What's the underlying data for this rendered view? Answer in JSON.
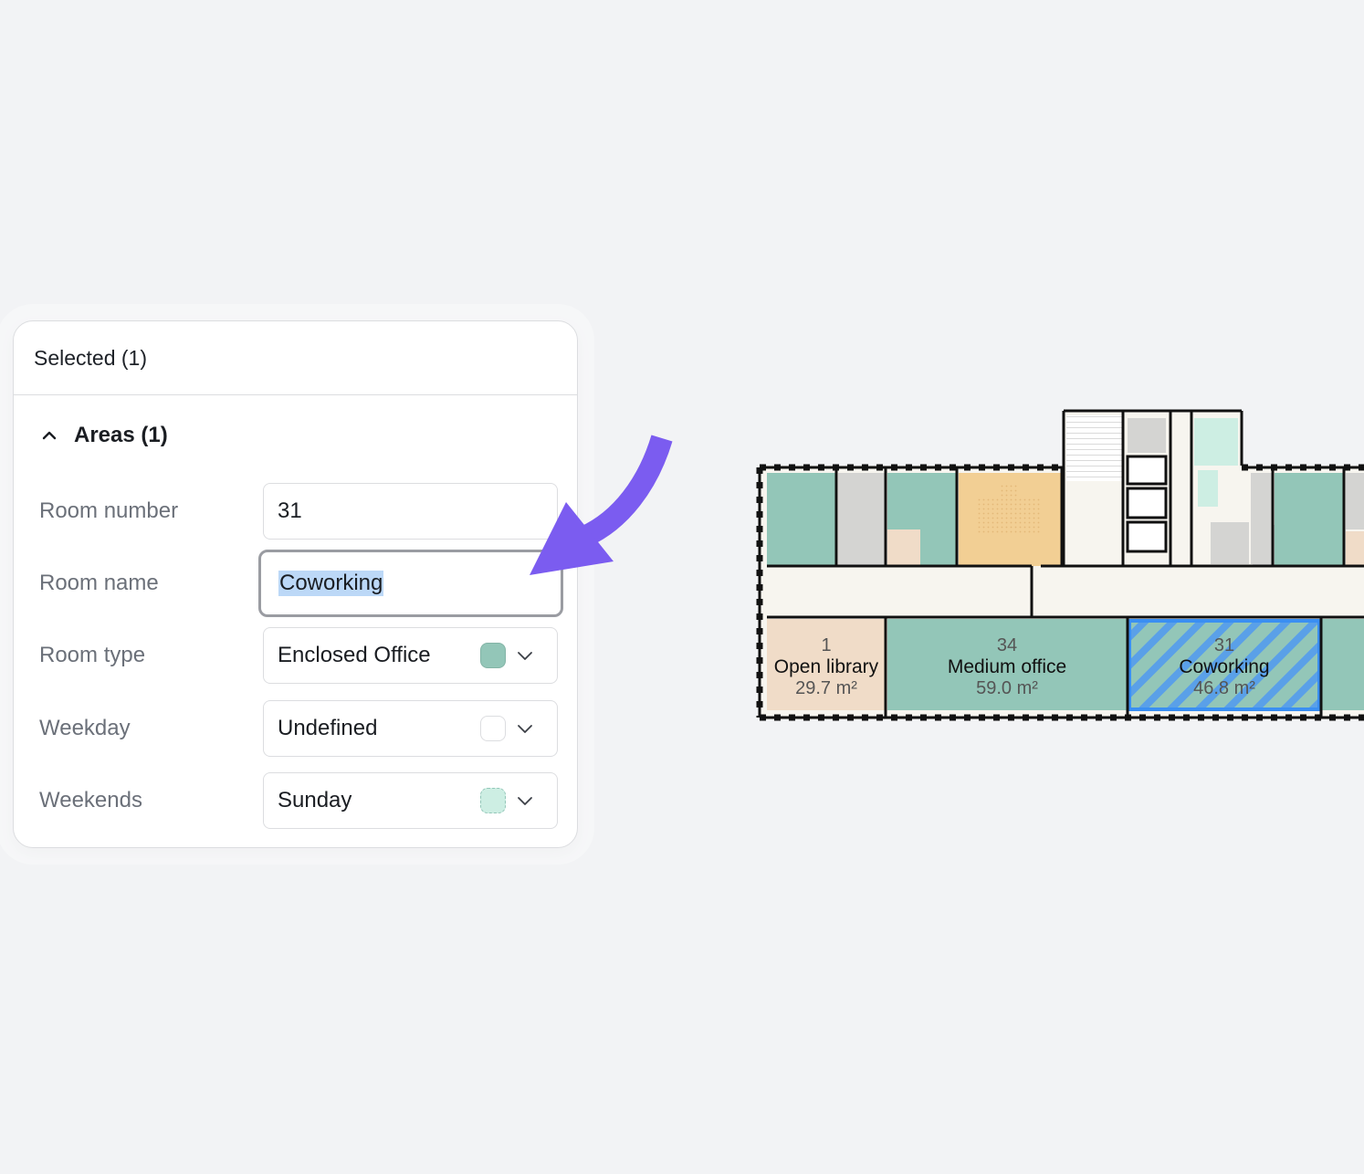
{
  "panel": {
    "title": "Selected (1)",
    "section_title": "Areas (1)",
    "fields": {
      "room_number": {
        "label": "Room number",
        "value": "31"
      },
      "room_name": {
        "label": "Room name",
        "value": "Coworking"
      },
      "room_type": {
        "label": "Room type",
        "value": "Enclosed Office",
        "swatch": "#93c6b8"
      },
      "weekday": {
        "label": "Weekday",
        "value": "Undefined",
        "swatch": "#ffffff"
      },
      "weekends": {
        "label": "Weekends",
        "value": "Sunday",
        "swatch": "#cdeee3"
      }
    }
  },
  "floorplan": {
    "rooms": [
      {
        "number": "1",
        "name": "Open library",
        "area": "29.7 m²"
      },
      {
        "number": "34",
        "name": "Medium office",
        "area": "59.0 m²"
      },
      {
        "number": "31",
        "name": "Coworking",
        "area": "46.8 m²"
      }
    ]
  },
  "colors": {
    "accent_arrow": "#7b5cf0",
    "selection_blue": "#3a8ff2",
    "office_green": "#93c6b8",
    "library_beige": "#f0dcc8",
    "corridor": "#f7f5ef",
    "kitchen_orange": "#f2cf94"
  }
}
